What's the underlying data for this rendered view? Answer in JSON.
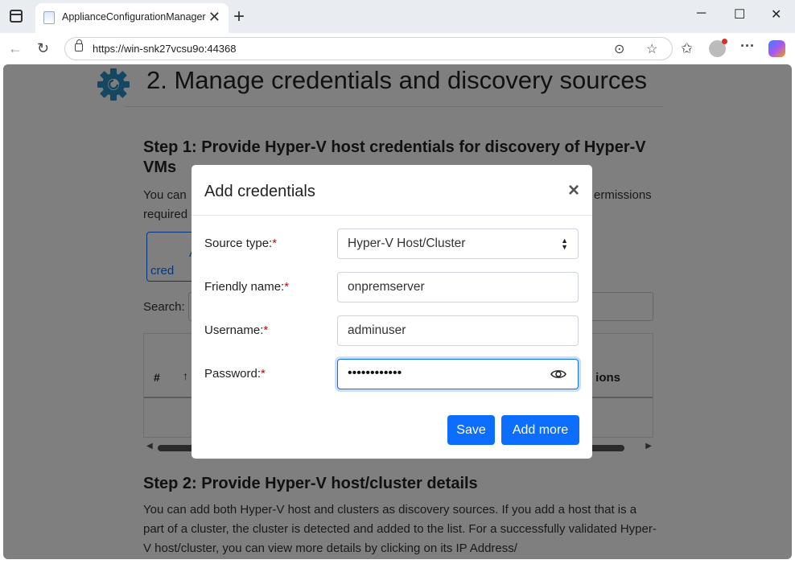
{
  "browser": {
    "tab_title": "ApplianceConfigurationManager",
    "tab_close": "✕",
    "new_tab": "+",
    "window_controls": {
      "minimize": "─",
      "maximize": "☐",
      "close": "✕"
    },
    "url": "https://win-snk27vcsu9o:44368",
    "icons": [
      "back-arrow-icon",
      "refresh-icon",
      "lock-icon",
      "reader-icon",
      "favorite-star-icon",
      "favorites-list-icon",
      "profile-icon",
      "more-icon",
      "copilot-icon"
    ]
  },
  "page": {
    "title": "2. Manage credentials and discovery sources",
    "step1": {
      "heading": "Step 1: Provide Hyper-V host credentials for discovery of Hyper-V VMs",
      "desc_line1_start": "You can",
      "desc_line1_end": "ermissions",
      "desc_line2": "required",
      "add_button_line1": "A",
      "add_button_line2": "cred",
      "search_label": "Search:",
      "table_headers": {
        "index": "#",
        "sort": "↑",
        "actions": "ions"
      }
    },
    "step2": {
      "heading": "Step 2: Provide Hyper-V host/cluster details",
      "desc": "You can add both Hyper-V host and clusters as discovery sources. If you add a host that is a part of a cluster, the cluster is detected and added to the list. For a successfully validated Hyper-V host/cluster, you can view more details by clicking on its IP Address/"
    }
  },
  "modal": {
    "title": "Add credentials",
    "close": "×",
    "required_marker": "*",
    "fields": {
      "source_type": {
        "label": "Source type:",
        "value": "Hyper-V Host/Cluster"
      },
      "friendly_name": {
        "label": "Friendly name:",
        "value": "onpremserver"
      },
      "username": {
        "label": "Username:",
        "value": "adminuser"
      },
      "password": {
        "label": "Password:",
        "value": "••••••••••••"
      }
    },
    "buttons": {
      "save": "Save",
      "add_more": "Add more"
    }
  },
  "colors": {
    "primary": "#0d6efd",
    "required": "#cc0000",
    "gear": "#2a8fc4"
  }
}
